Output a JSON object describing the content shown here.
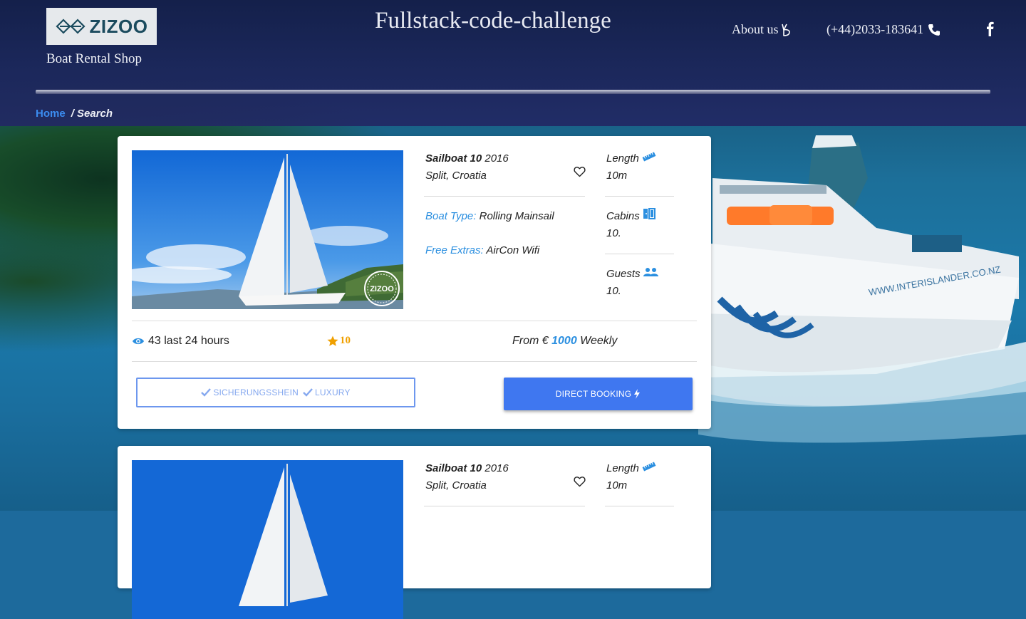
{
  "header": {
    "logo_text": "ZIZOO",
    "shop_name": "Boat Rental Shop",
    "site_title": "Fullstack-code-challenge",
    "nav": {
      "about_label": "About us",
      "phone_label": "(+44)2033-183641"
    }
  },
  "breadcrumb": {
    "home_label": "Home",
    "current_label": "/ Search"
  },
  "background": {
    "ship_hull_text": "WWW.INTERISLANDER.CO.NZ"
  },
  "listings": [
    {
      "boat_name": "Sailboat 10",
      "year": "2016",
      "location": "Split, Croatia",
      "image_badge": "ZIZOO",
      "boat_type_key": "Boat Type:",
      "boat_type_value": "Rolling Mainsail",
      "extras_key": "Free Extras:",
      "extras_value": "AirCon Wifi",
      "length_label": "Length",
      "length_value": "10m",
      "cabins_label": "Cabins",
      "cabins_value": "10.",
      "guests_label": "Guests",
      "guests_value": "10.",
      "views_text": "43 last 24 hours",
      "rating": "10",
      "price_prefix": "From €",
      "price_value": "1000",
      "price_suffix": "Weekly",
      "tags": [
        "SICHERUNGSSHEIN",
        "LUXURY"
      ],
      "booking_label": "DIRECT BOOKING"
    },
    {
      "boat_name": "Sailboat 10",
      "year": "2016",
      "location": "Split, Croatia",
      "length_label": "Length",
      "length_value": "10m"
    }
  ],
  "colors": {
    "accent_blue": "#2b8fe0",
    "button_blue": "#3f77f0",
    "rating_orange": "#f0a000"
  },
  "icons": {
    "about": "peace-hand-icon",
    "phone": "phone-icon",
    "social": "facebook-icon",
    "favorite": "heart-outline-icon",
    "length": "ruler-icon",
    "cabins": "door-icon",
    "guests": "users-icon",
    "views": "eye-icon",
    "rating": "star-icon",
    "tag": "check-icon",
    "booking": "bolt-icon"
  }
}
